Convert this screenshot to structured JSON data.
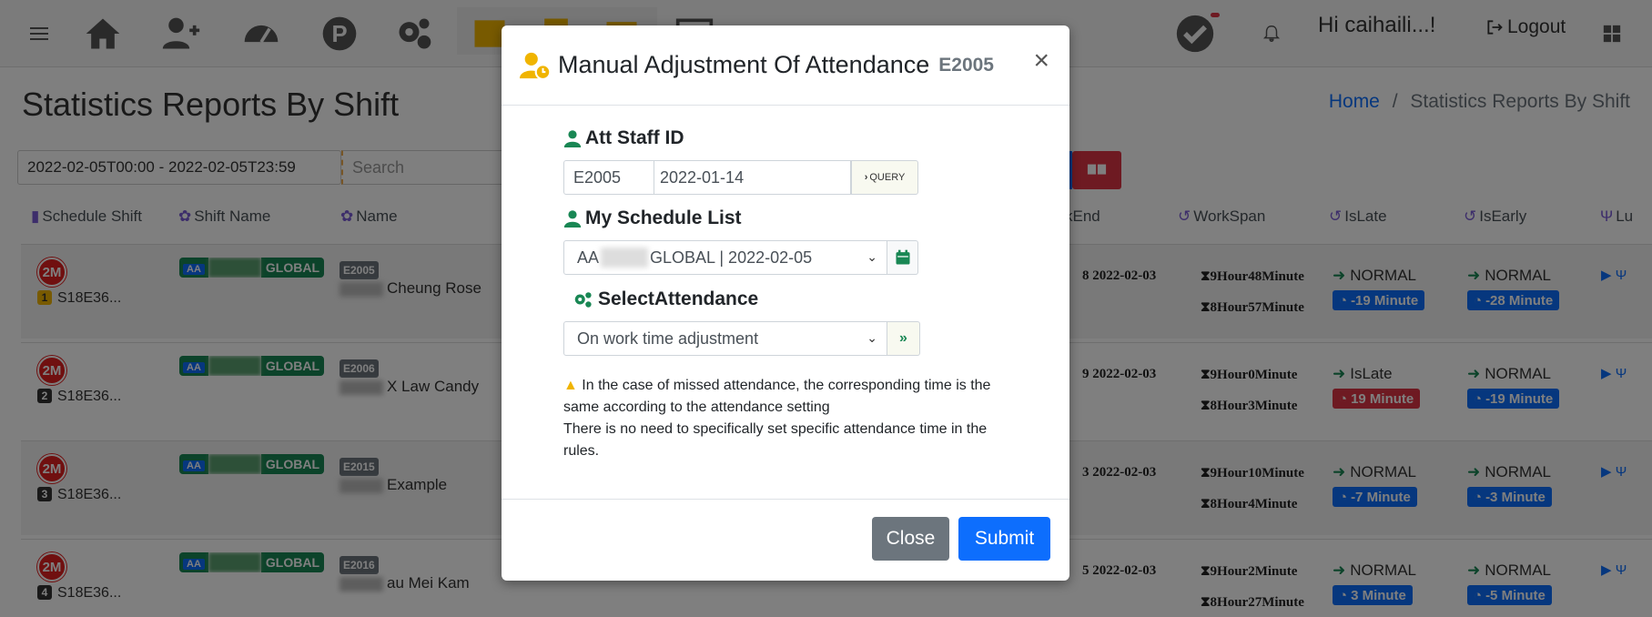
{
  "topbar": {
    "greeting": "Hi caihaili...!",
    "logout": "Logout"
  },
  "page": {
    "title": "Statistics Reports By Shift",
    "breadcrumb_home": "Home",
    "breadcrumb_sep": "/",
    "breadcrumb_current": "Statistics Reports By Shift",
    "daterange": "2022-02-05T00:00 - 2022-02-05T23:59",
    "search_placeholder": "Search"
  },
  "table": {
    "headers": {
      "schedule_shift": "Schedule Shift",
      "shift_name": "Shift Name",
      "name": "Name",
      "work_end": "kEnd",
      "work_span": "WorkSpan",
      "is_late": "IsLate",
      "is_early": "IsEarly",
      "lunch": "Lu"
    },
    "rows": [
      {
        "badge": "2M",
        "idx": "1",
        "sched": "S18E36...",
        "aa": "AA",
        "gl": "GLOBAL",
        "code": "E2005",
        "name": "Cheung Rose",
        "end": "8 2022-02-03",
        "span1": "9Hour48Minute",
        "span2": "8Hour57Minute",
        "late": "NORMAL",
        "late_min": "-19 Minute",
        "early": "NORMAL",
        "early_min": "-28 Minute"
      },
      {
        "badge": "2M",
        "idx": "2",
        "sched": "S18E36...",
        "aa": "AA",
        "gl": "GLOBAL",
        "code": "E2006",
        "name": "X Law Candy",
        "end": "9 2022-02-03",
        "span1": "9Hour0Minute",
        "span2": "8Hour3Minute",
        "late": "IsLate",
        "late_min": "19 Minute",
        "early": "NORMAL",
        "early_min": "-19 Minute"
      },
      {
        "badge": "2M",
        "idx": "3",
        "sched": "S18E36...",
        "aa": "AA",
        "gl": "GLOBAL",
        "code": "E2015",
        "name": "Example",
        "end": "3 2022-02-03",
        "span1": "9Hour10Minute",
        "span2": "8Hour4Minute",
        "late": "NORMAL",
        "late_min": "-7 Minute",
        "early": "NORMAL",
        "early_min": "-3 Minute"
      },
      {
        "badge": "2M",
        "idx": "4",
        "sched": "S18E36...",
        "aa": "AA",
        "gl": "GLOBAL",
        "code": "E2016",
        "name": "au Mei Kam",
        "end": "5 2022-02-03",
        "span1": "9Hour2Minute",
        "span2": "8Hour27Minute",
        "late": "NORMAL",
        "late_min": "3 Minute",
        "early": "NORMAL",
        "early_min": "-5 Minute"
      }
    ]
  },
  "modal": {
    "title": "Manual Adjustment Of Attendance",
    "staff_code": "E2005",
    "close_x": "×",
    "att_staff_label": "Att Staff ID",
    "staff_id_value": "E2005",
    "date_value": "2022-01-14",
    "query_label": "QUERY",
    "schedule_label": "My Schedule List",
    "schedule_prefix": "AA",
    "schedule_suffix": "GLOBAL | 2022-02-05",
    "select_label": "SelectAttendance",
    "select_value": "On work time adjustment",
    "go_label": "»",
    "note_line1": "In the case of missed attendance, the corresponding time is the same according to the attendance setting",
    "note_line2": "There is no need to specifically set specific attendance time in the rules.",
    "close_button": "Close",
    "submit_button": "Submit"
  },
  "colors": {
    "primary": "#0d6efd",
    "success": "#198754",
    "danger": "#dc3545",
    "secondary": "#6c757d",
    "warning": "#f0b400"
  }
}
